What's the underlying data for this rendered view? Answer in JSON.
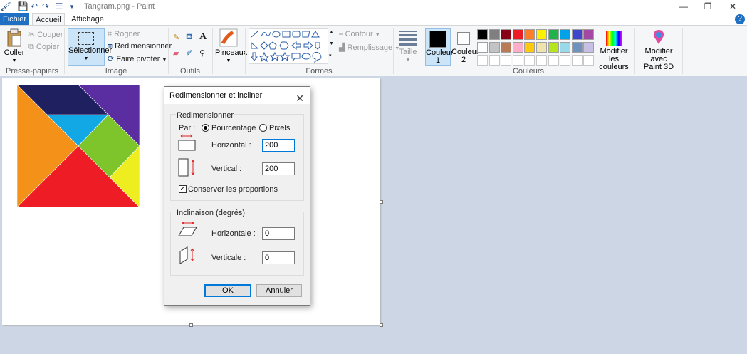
{
  "window": {
    "title": "Tangram.png - Paint",
    "minimize": "—",
    "maximize": "❐",
    "close": "✕",
    "help": "?"
  },
  "tabs": {
    "file": "Fichier",
    "home": "Accueil",
    "view": "Affichage"
  },
  "ribbon": {
    "clipboard": {
      "paste": "Coller",
      "cut": "Couper",
      "copy": "Copier",
      "group": "Presse-papiers"
    },
    "image": {
      "select": "Sélectionner",
      "crop": "Rogner",
      "resize": "Redimensionner",
      "rotate": "Faire pivoter",
      "group": "Image"
    },
    "tools": {
      "group": "Outils"
    },
    "brushes": {
      "label": "Pinceaux"
    },
    "shapes": {
      "outline": "Contour",
      "fill": "Remplissage",
      "group": "Formes"
    },
    "size": {
      "label": "Taille"
    },
    "colors": {
      "color1": "Couleur",
      "color1_num": "1",
      "color2": "Couleur",
      "color2_num": "2",
      "edit": "Modifier les",
      "edit2": "couleurs",
      "paint3d": "Modifier avec",
      "paint3d2": "Paint 3D",
      "group": "Couleurs",
      "color1_hex": "#000000",
      "color2_hex": "#ffffff",
      "palette_row1": [
        "#000000",
        "#7f7f7f",
        "#880015",
        "#ed1c24",
        "#ff7f27",
        "#fff200",
        "#22b14c",
        "#00a2e8",
        "#3f48cc",
        "#a349a4"
      ],
      "palette_row2": [
        "#ffffff",
        "#c3c3c3",
        "#b97a57",
        "#ffaec9",
        "#ffc90e",
        "#efe4b0",
        "#b5e61d",
        "#99d9ea",
        "#7092be",
        "#c8bfe7"
      ]
    }
  },
  "dialog": {
    "title": "Redimensionner et incliner",
    "resize_group": "Redimensionner",
    "by": "Par :",
    "percent": "Pourcentage",
    "pixels": "Pixels",
    "horizontal": "Horizontal :",
    "horizontal_value": "200",
    "vertical": "Vertical :",
    "vertical_value": "200",
    "keep_ratio": "Conserver les proportions",
    "skew_group": "Inclinaison (degrés)",
    "skew_h": "Horizontale :",
    "skew_h_value": "0",
    "skew_v": "Verticale :",
    "skew_v_value": "0",
    "ok": "OK",
    "cancel": "Annuler"
  },
  "tangram_colors": {
    "navy": "#1f2060",
    "purple": "#5a2ea0",
    "orange": "#f39119",
    "cyan": "#12a8e6",
    "green": "#7dc52b",
    "red": "#ee1c24",
    "yellow": "#eded1f"
  }
}
